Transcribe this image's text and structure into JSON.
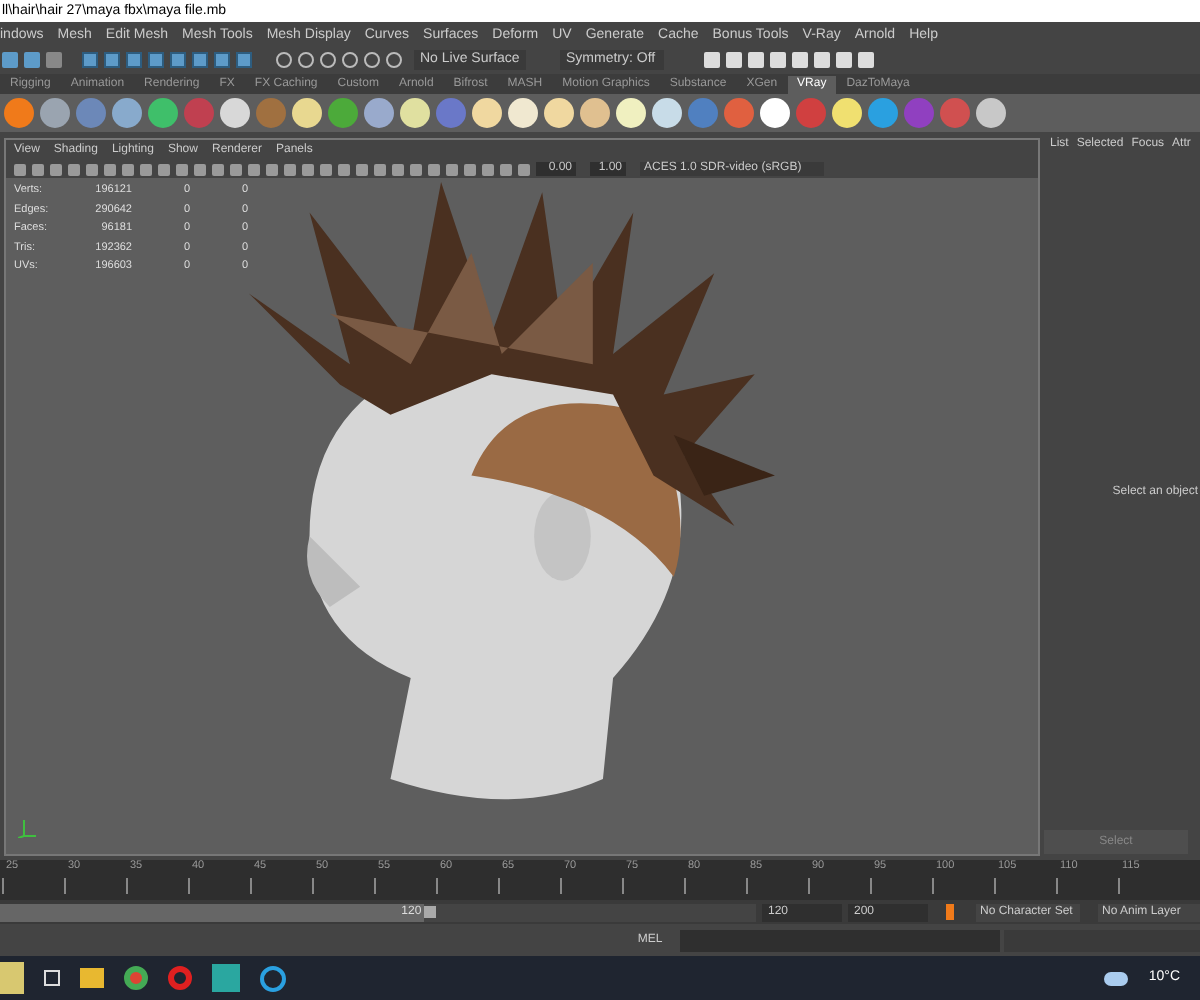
{
  "window": {
    "title": "ll\\hair\\hair 27\\maya fbx\\maya file.mb"
  },
  "menu": [
    "indows",
    "Mesh",
    "Edit Mesh",
    "Mesh Tools",
    "Mesh Display",
    "Curves",
    "Surfaces",
    "Deform",
    "UV",
    "Generate",
    "Cache",
    "Bonus Tools",
    "V-Ray",
    "Arnold",
    "Help"
  ],
  "status_line": {
    "live_surface": "No Live Surface",
    "symmetry": "Symmetry: Off"
  },
  "shelf_tabs": [
    {
      "label": "Rigging",
      "selected": false
    },
    {
      "label": "Animation",
      "selected": false
    },
    {
      "label": "Rendering",
      "selected": false
    },
    {
      "label": "FX",
      "selected": false
    },
    {
      "label": "FX Caching",
      "selected": false
    },
    {
      "label": "Custom",
      "selected": false
    },
    {
      "label": "Arnold",
      "selected": false
    },
    {
      "label": "Bifrost",
      "selected": false
    },
    {
      "label": "MASH",
      "selected": false
    },
    {
      "label": "Motion Graphics",
      "selected": false
    },
    {
      "label": "Substance",
      "selected": false
    },
    {
      "label": "XGen",
      "selected": false
    },
    {
      "label": "VRay",
      "selected": true
    },
    {
      "label": "DazToMaya",
      "selected": false
    }
  ],
  "panel_menu": [
    "View",
    "Shading",
    "Lighting",
    "Show",
    "Renderer",
    "Panels"
  ],
  "viewport_toolbar": {
    "exposure": "0.00",
    "gamma": "1.00",
    "color_space": "ACES 1.0 SDR-video (sRGB)"
  },
  "stats": [
    {
      "label": "Verts:",
      "values": [
        "196121",
        "0",
        "0"
      ]
    },
    {
      "label": "Edges:",
      "values": [
        "290642",
        "0",
        "0"
      ]
    },
    {
      "label": "Faces:",
      "values": [
        "96181",
        "0",
        "0"
      ]
    },
    {
      "label": "Tris:",
      "values": [
        "192362",
        "0",
        "0"
      ]
    },
    {
      "label": "UVs:",
      "values": [
        "196603",
        "0",
        "0"
      ]
    }
  ],
  "viewport": {
    "kind": "picture"
  },
  "attribute_tabs": [
    "List",
    "Selected",
    "Focus",
    "Attr"
  ],
  "attribute_hint": "Select an object",
  "select_button": "Select",
  "timeline_ticks": [
    "25",
    "30",
    "35",
    "40",
    "45",
    "50",
    "55",
    "60",
    "65",
    "70",
    "75",
    "80",
    "85",
    "90",
    "95",
    "100",
    "105",
    "110",
    "115"
  ],
  "range": {
    "level": 0.56,
    "slider_end": "120",
    "end": "120",
    "total_end": "200",
    "character_set": "No Character Set",
    "anim_layer": "No Anim Layer"
  },
  "command_line": {
    "language": "MEL"
  },
  "taskbar": {
    "weather": "10°C"
  }
}
